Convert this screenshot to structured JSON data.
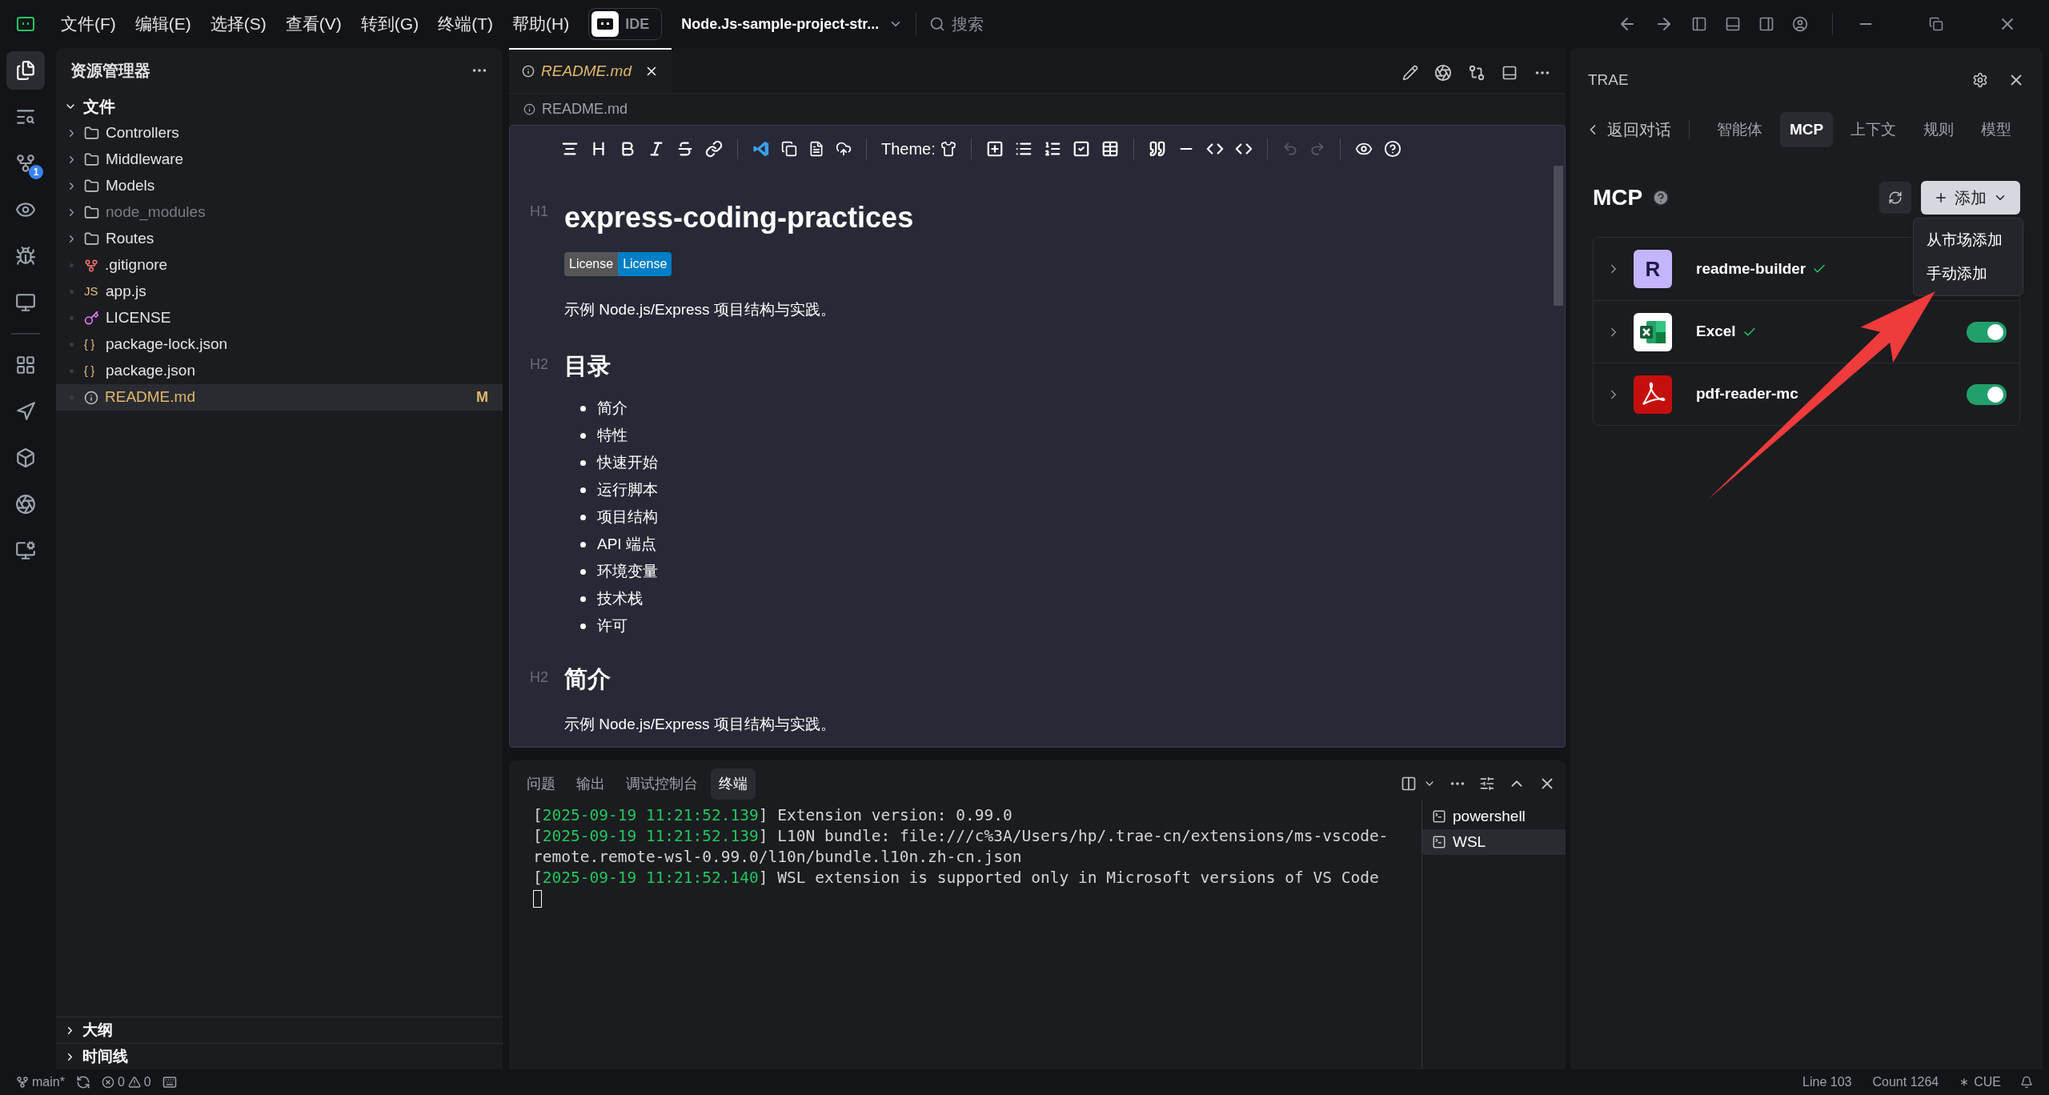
{
  "title_bar": {
    "menus": [
      "文件(F)",
      "编辑(E)",
      "选择(S)",
      "查看(V)",
      "转到(G)",
      "终端(T)",
      "帮助(H)"
    ],
    "mode_toggle": {
      "label": "IDE",
      "selected": false
    },
    "project": "Node.Js-sample-project-str...",
    "search": {
      "placeholder": "搜索"
    }
  },
  "activity_bar": {
    "items": [
      {
        "selected": true
      },
      {
        "selected": false
      },
      {
        "selected": false,
        "badge": "1"
      },
      {
        "selected": false
      },
      {
        "selected": false
      },
      {
        "selected": false
      },
      {
        "selected": false
      },
      {
        "selected": false
      },
      {
        "selected": false
      },
      {
        "selected": false
      },
      {
        "selected": false
      }
    ]
  },
  "explorer": {
    "title": "资源管理器",
    "root": {
      "label": "文件",
      "expanded": true,
      "children": [
        {
          "label": "Controllers",
          "kind": "folder",
          "selected": false,
          "dimmed": false
        },
        {
          "label": "Middleware",
          "kind": "folder",
          "selected": false,
          "dimmed": false
        },
        {
          "label": "Models",
          "kind": "folder",
          "selected": false,
          "dimmed": false
        },
        {
          "label": "node_modules",
          "kind": "folder",
          "selected": false,
          "dimmed": true
        },
        {
          "label": "Routes",
          "kind": "folder",
          "selected": false,
          "dimmed": false
        },
        {
          "label": ".gitignore",
          "kind": "gitfile",
          "selected": false,
          "dimmed": false
        },
        {
          "label": "app.js",
          "kind": "script",
          "icon_text": "JS",
          "selected": false,
          "dimmed": false
        },
        {
          "label": "LICENSE",
          "kind": "license",
          "selected": false,
          "dimmed": false
        },
        {
          "label": "package-lock.json",
          "kind": "json",
          "icon_text": "{ }",
          "selected": false,
          "dimmed": false
        },
        {
          "label": "package.json",
          "kind": "json",
          "icon_text": "{ }",
          "selected": false,
          "dimmed": false
        },
        {
          "label": "README.md",
          "kind": "doc",
          "selected": true,
          "dimmed": false,
          "status": "M"
        }
      ]
    },
    "sections": [
      {
        "label": "大纲",
        "expanded": false
      },
      {
        "label": "时间线",
        "expanded": false
      }
    ]
  },
  "editor": {
    "tabs": [
      {
        "label": "README.md",
        "selected": true,
        "preview": true
      }
    ],
    "breadcrumb": "README.md",
    "toolbar": {
      "theme_label": "Theme:"
    },
    "content": [
      {
        "kind": "h1",
        "marker": "H1",
        "text": "express-coding-practices"
      },
      {
        "kind": "badge",
        "left": "License",
        "right": "License"
      },
      {
        "kind": "p",
        "text": "示例 Node.js/Express 项目结构与实践。"
      },
      {
        "kind": "h2",
        "marker": "H2",
        "text": "目录"
      },
      {
        "kind": "ul",
        "items": [
          "简介",
          "特性",
          "快速开始",
          "运行脚本",
          "项目结构",
          "API 端点",
          "环境变量",
          "技术栈",
          "许可"
        ]
      },
      {
        "kind": "h2",
        "marker": "H2",
        "text": "简介"
      },
      {
        "kind": "p",
        "text": "示例 Node.js/Express 项目结构与实践。"
      }
    ]
  },
  "panel": {
    "tabs": [
      {
        "label": "问题",
        "selected": false
      },
      {
        "label": "输出",
        "selected": false
      },
      {
        "label": "调试控制台",
        "selected": false
      },
      {
        "label": "终端",
        "selected": true
      }
    ],
    "terminal_lines": [
      {
        "parts": [
          {
            "kind": "plain",
            "text": "["
          },
          {
            "kind": "time",
            "text": "2025-09-19 11:21:52.139"
          },
          {
            "kind": "plain",
            "text": "] Extension version: 0.99.0"
          }
        ]
      },
      {
        "parts": [
          {
            "kind": "plain",
            "text": "["
          },
          {
            "kind": "time",
            "text": "2025-09-19 11:21:52.139"
          },
          {
            "kind": "plain",
            "text": "] L10N bundle: file:///c%3A/Users/hp/.trae-cn/extensions/ms-vscode-"
          }
        ]
      },
      {
        "parts": [
          {
            "kind": "plain",
            "text": "remote.remote-wsl-0.99.0/l10n/bundle.l10n.zh-cn.json"
          }
        ]
      },
      {
        "parts": [
          {
            "kind": "plain",
            "text": "["
          },
          {
            "kind": "time",
            "text": "2025-09-19 11:21:52.140"
          },
          {
            "kind": "plain",
            "text": "] WSL extension is supported only in Microsoft versions of VS Code"
          }
        ]
      }
    ],
    "terminals": [
      {
        "label": "powershell",
        "selected": false
      },
      {
        "label": "WSL",
        "selected": true
      }
    ]
  },
  "ai_panel": {
    "title": "TRAE",
    "back": "返回对话",
    "tabs": [
      {
        "label": "智能体",
        "selected": false
      },
      {
        "label": "MCP",
        "selected": true
      },
      {
        "label": "上下文",
        "selected": false
      },
      {
        "label": "规则",
        "selected": false
      },
      {
        "label": "模型",
        "selected": false
      }
    ],
    "heading": "MCP",
    "add_button": "添加",
    "add_menu": [
      "从市场添加",
      "手动添加"
    ],
    "servers": [
      {
        "name": "readme-builder",
        "kind": "letter",
        "letter": "R",
        "verified": true
      },
      {
        "name": "Excel",
        "kind": "sheet",
        "verified": true,
        "on": true
      },
      {
        "name": "pdf-reader-mc",
        "kind": "doc",
        "verified": false,
        "on": true
      }
    ]
  },
  "status_bar": {
    "branch": "main*",
    "errors": "0",
    "warnings": "0",
    "line": "Line 103",
    "count": "Count 1264",
    "language": "CUE"
  }
}
